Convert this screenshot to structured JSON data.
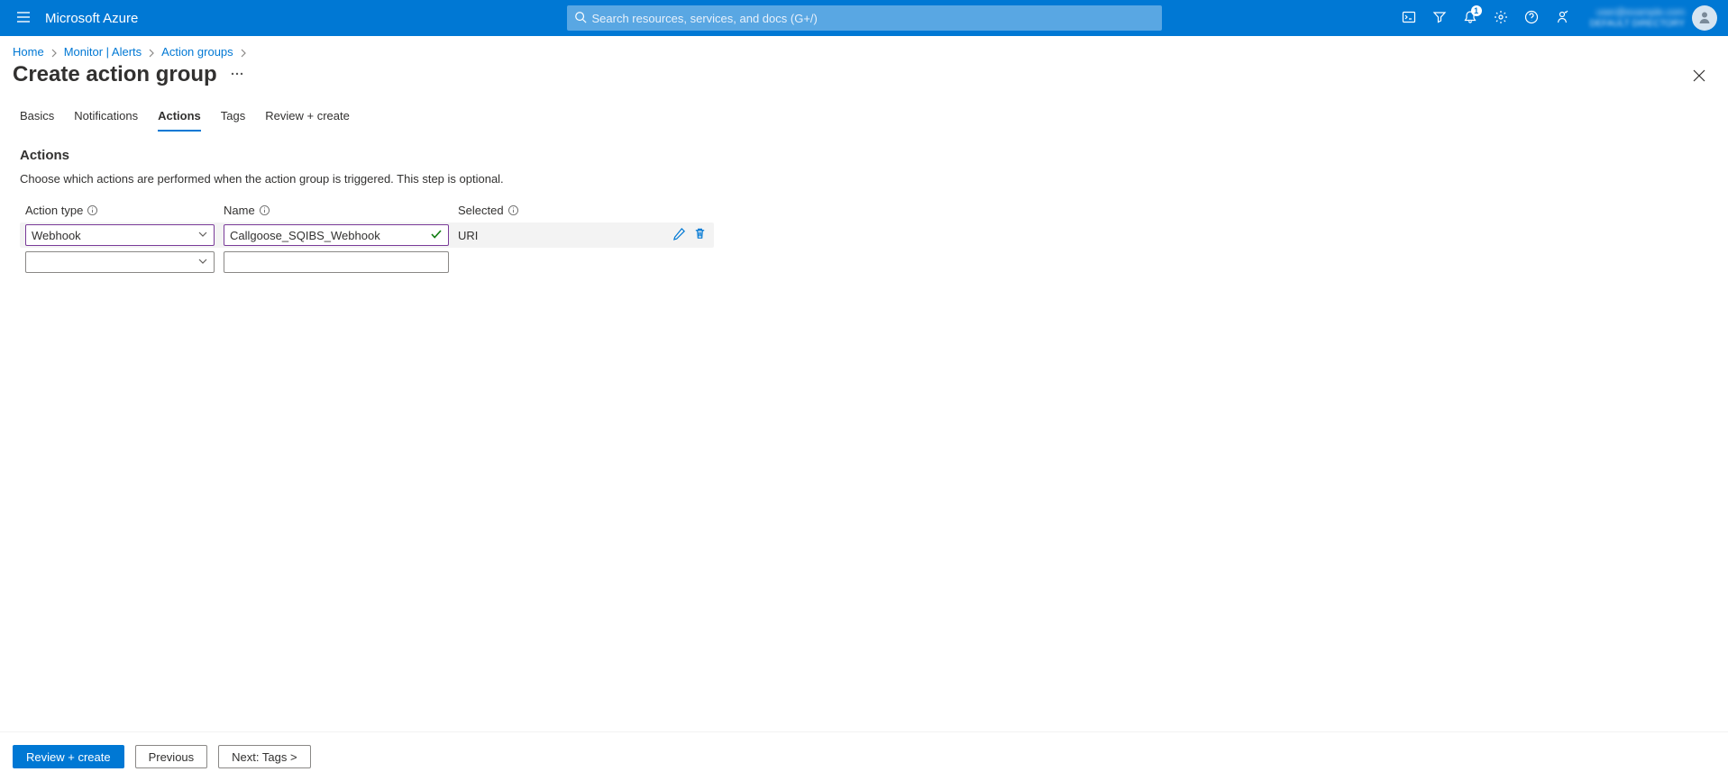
{
  "topbar": {
    "brand": "Microsoft Azure",
    "search_placeholder": "Search resources, services, and docs (G+/)",
    "notification_badge": "1",
    "account_email": "user@example.com",
    "account_directory": "DEFAULT DIRECTORY"
  },
  "breadcrumbs": {
    "items": [
      "Home",
      "Monitor | Alerts",
      "Action groups"
    ]
  },
  "page": {
    "title": "Create action group"
  },
  "tabs": {
    "items": [
      "Basics",
      "Notifications",
      "Actions",
      "Tags",
      "Review + create"
    ],
    "active_index": 2
  },
  "section": {
    "title": "Actions",
    "description": "Choose which actions are performed when the action group is triggered. This step is optional."
  },
  "table": {
    "headers": {
      "action_type": "Action type",
      "name": "Name",
      "selected": "Selected"
    },
    "rows": [
      {
        "action_type": "Webhook",
        "name": "Callgoose_SQIBS_Webhook",
        "selected": "URI",
        "name_valid": true
      },
      {
        "action_type": "",
        "name": "",
        "selected": "",
        "name_valid": false
      }
    ]
  },
  "footer": {
    "primary": "Review + create",
    "previous": "Previous",
    "next": "Next: Tags >"
  }
}
